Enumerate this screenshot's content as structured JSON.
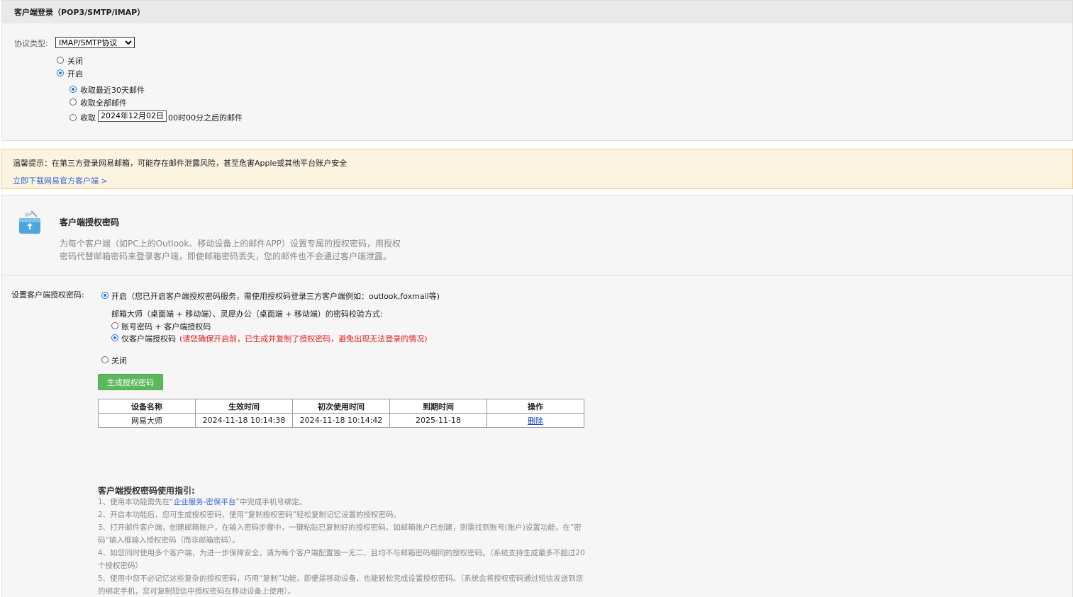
{
  "pop_section": {
    "title": "客户端登录（POP3/SMTP/IMAP）",
    "protocol_label": "协议类型:",
    "protocol_selected": "IMAP/SMTP协议",
    "off_label": "关闭",
    "on_label": "开启",
    "opt_recent": "收取最近30天邮件",
    "opt_all": "收取全部邮件",
    "opt_since_prefix": "收取",
    "opt_since_date": "2024年12月02日",
    "opt_since_suffix": "00时00分之后的邮件"
  },
  "warning": {
    "text": "温馨提示：在第三方登录网易邮箱，可能存在邮件泄露风险，甚至危害Apple或其他平台账户安全",
    "download_link": "立即下载网易官方客户端 >"
  },
  "auth_section": {
    "icon": "broom-bag-icon",
    "title": "客户端授权密码",
    "desc_line1": "为每个客户端（如PC上的Outlook、移动设备上的邮件APP）设置专属的授权密码，用授权",
    "desc_line2": "密码代替邮箱密码来登录客户端，即使邮箱密码丢失，您的邮件也不会通过客户端泄露。",
    "setting_label": "设置客户端授权密码:",
    "on_text": "开启（您已开启客户端授权密码服务，需使用授权码登录三方客户端例如：outlook,foxmail等)",
    "verify_label": "邮箱大师（桌面端 + 移动端）、灵犀办公（桌面端 + 移动端）的密码校验方式:",
    "verify_opt1": "账号密码 + 客户端授权码",
    "verify_opt2": "仅客户端授权码",
    "verify_opt2_note": "(请您确保开启前，已生成并复制了授权密码，避免出现无法登录的情况)",
    "off_text": "关闭",
    "generate_button": "生成授权密码",
    "table": {
      "headers": [
        "设备名称",
        "生效时间",
        "初次使用时间",
        "到期时间",
        "操作"
      ],
      "row": {
        "device": "网易大师",
        "effective": "2024-11-18 10:14:38",
        "first_use": "2024-11-18 10:14:42",
        "expire": "2025-11-18",
        "action": "删除"
      }
    }
  },
  "guide": {
    "title": "客户端授权密码使用指引:",
    "l1_pre": "1、使用本功能需先在“",
    "l1_link": "企业服务-密保平台",
    "l1_post": "”中完成手机号绑定。",
    "l2": "2、开启本功能后，您可生成授权密码，使用“复制授权密码”轻松复制记忆设置的授权密码。",
    "l3a": "3、打开邮件客户端，创建邮箱账户，在输入密码步骤中，一键粘贴已复制好的授权密码。如邮箱账户已创建，则需找到账号(账户)设置功能，在“密",
    "l3b": "码”输入框输入授权密码（而非邮箱密码）。",
    "l4a": "4、如您同时使用多个客户端，为进一步保障安全，请为每个客户端配置独一无二、且均不与邮箱密码相同的授权密码。（系统支持生成最多不超过20",
    "l4b": "个授权密码）",
    "l5a": "5、使用中您不必记忆这些复杂的授权密码，巧用“复制”功能，即便是移动设备，也能轻松完成设置授权密码。（系统会将授权密码通过短信发送到您",
    "l5b": "的绑定手机，您可复制短信中授权密码在移动设备上使用）。"
  }
}
